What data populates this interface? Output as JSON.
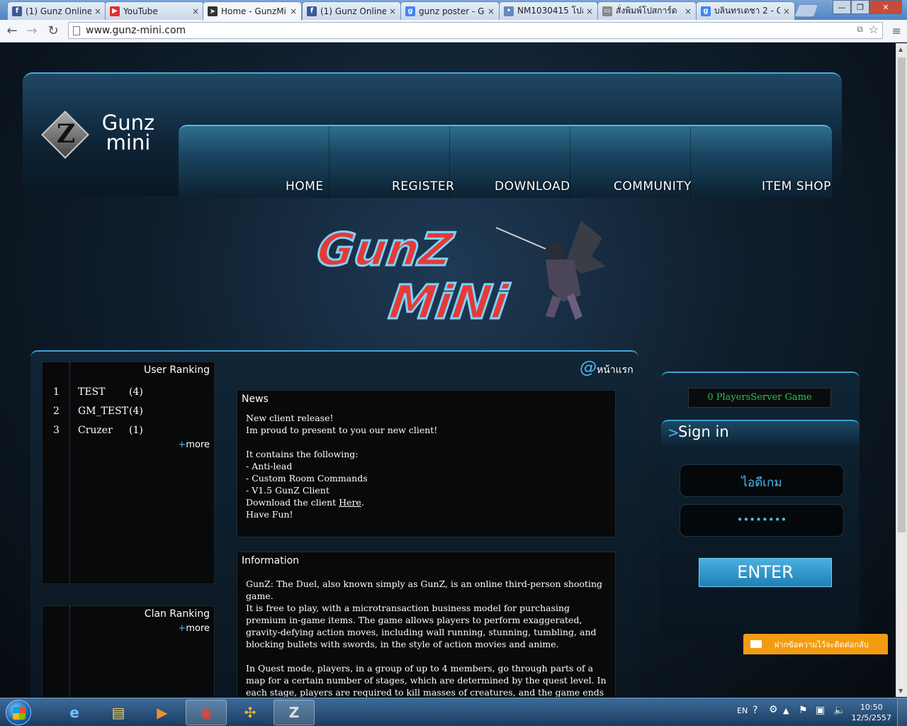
{
  "browser": {
    "tabs": [
      {
        "title": "(1) Gunz Online",
        "icon": "facebook-icon",
        "color": "#3b5998",
        "glyph": "f"
      },
      {
        "title": "YouTube",
        "icon": "youtube-icon",
        "color": "#e52d27",
        "glyph": "▶"
      },
      {
        "title": "Home - GunzMi",
        "icon": "gunz-icon",
        "color": "#333333",
        "glyph": "➤"
      },
      {
        "title": "(1) Gunz Online",
        "icon": "facebook-icon",
        "color": "#3b5998",
        "glyph": "f"
      },
      {
        "title": "gunz poster - Go",
        "icon": "google-icon",
        "color": "#4285f4",
        "glyph": "g"
      },
      {
        "title": "NM1030415 โปส",
        "icon": "site-icon",
        "color": "#6688bb",
        "glyph": "•"
      },
      {
        "title": "สั่งพิมพ์โปสการ์ด",
        "icon": "page-icon",
        "color": "#888888",
        "glyph": "▭"
      },
      {
        "title": "บลินทรเดชา 2 - G",
        "icon": "google-icon",
        "color": "#4285f4",
        "glyph": "g"
      }
    ],
    "url": "www.gunz-mini.com"
  },
  "header": {
    "logo_line1": "Gunz",
    "logo_line2": "mini",
    "logo_letter": "Z",
    "nav": [
      "HOME",
      "REGISTER",
      "DOWNLOAD",
      "COMMUNITY",
      "ITEM SHOP"
    ]
  },
  "banner": {
    "line1": "GunZ",
    "line2": "MiNi"
  },
  "breadcrumb": {
    "at": "@",
    "label": "หน้าแรก"
  },
  "user_ranking": {
    "title": "User Ranking",
    "rows": [
      {
        "rank": "1",
        "name": "TEST",
        "score": "(4)"
      },
      {
        "rank": "2",
        "name": "GM_TEST",
        "score": "(4)"
      },
      {
        "rank": "3",
        "name": "Cruzer",
        "score": "(1)"
      }
    ],
    "more_plus": "+",
    "more_label": "more"
  },
  "clan_ranking": {
    "title": "Clan Ranking",
    "more_plus": "+",
    "more_label": "more"
  },
  "news": {
    "title": "News",
    "lines": [
      "New client release!",
      "Im proud to present to you our new client!",
      "",
      "It contains the following:",
      "- Anti-lead",
      "- Custom Room Commands",
      "- V1.5 GunZ Client"
    ],
    "download_prefix": "Download the client ",
    "download_link": "Here",
    "download_suffix": ".",
    "closing": "Have Fun!"
  },
  "information": {
    "title": "Information",
    "body": "GunZ: The Duel, also known simply as GunZ, is an online third-person shooting game.\nIt is free to play, with a microtransaction business model for purchasing premium in-game items. The game allows players to perform exaggerated, gravity-defying action moves, including wall running, stunning, tumbling, and blocking bullets with swords, in the style of action movies and anime.\n\nIn Quest mode, players, in a group of up to 4 members, go through parts of a map for a certain number of stages, which are determined by the quest level. In each stage, players are required to kill masses of creatures, and the game ends when every member of the player team dies or completes all of the stages. Quests can take place in the Prison,"
  },
  "server": {
    "status": "0 PlayersServer Game"
  },
  "signin": {
    "arrow": ">",
    "title": "Sign in",
    "id_placeholder": "ไอดีเกม",
    "password_mask": "••••••••",
    "enter_label": "ENTER"
  },
  "chat_widget": {
    "label": "ฝากข้อความไว้จะติดต่อกลับ"
  },
  "taskbar": {
    "lang": "EN",
    "time": "10:50",
    "date": "12/5/2557",
    "apps": [
      {
        "icon": "ie-icon",
        "glyph": "e"
      },
      {
        "icon": "explorer-icon",
        "glyph": "▤"
      },
      {
        "icon": "media-player-icon",
        "glyph": "▶"
      },
      {
        "icon": "chrome-icon",
        "glyph": "◉"
      },
      {
        "icon": "game-controller-icon",
        "glyph": "✣"
      },
      {
        "icon": "gunz-launcher-icon",
        "glyph": "Z"
      }
    ]
  },
  "colors": {
    "accent": "#4fb6e8",
    "server_status": "#29c24a",
    "chat": "#f39c12",
    "banner_text": "#e53a35"
  }
}
